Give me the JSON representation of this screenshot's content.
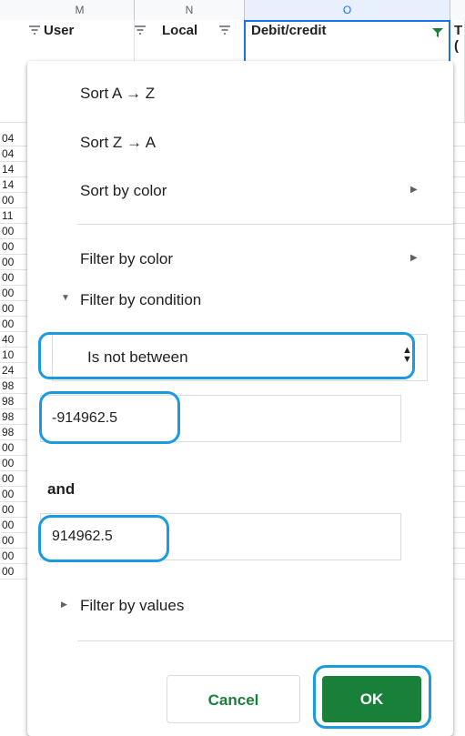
{
  "sheet": {
    "columns": [
      {
        "letter": "M"
      },
      {
        "letter": "N"
      },
      {
        "letter": "O"
      }
    ],
    "header_cells": {
      "user": "User",
      "local": "Local",
      "debit": "Debit/credit",
      "next": "T",
      "next2": "("
    },
    "row_numbers": [
      "04",
      "04",
      "14",
      "14",
      "00",
      "11",
      "00",
      "00",
      "00",
      "00",
      "00",
      "00",
      "00",
      "40",
      "10",
      "24",
      "98",
      "98",
      "98",
      "98",
      "00",
      "00",
      "00",
      "00",
      "00",
      "00",
      "00",
      "00",
      "00"
    ]
  },
  "menu": {
    "sort_az": "Sort A → Z",
    "sort_za": "Sort Z → A",
    "sort_by_color": "Sort by color",
    "filter_by_color": "Filter by color",
    "filter_by_condition": "Filter by condition",
    "filter_by_values": "Filter by values"
  },
  "condition": {
    "selected": "Is not between",
    "value1": "-914962.5",
    "and_label": "and",
    "value2": "914962.5"
  },
  "buttons": {
    "cancel": "Cancel",
    "ok": "OK"
  },
  "colors": {
    "accent_green": "#188038",
    "highlight_ring": "#1a9ae0",
    "selection_blue": "#1a73e8"
  }
}
